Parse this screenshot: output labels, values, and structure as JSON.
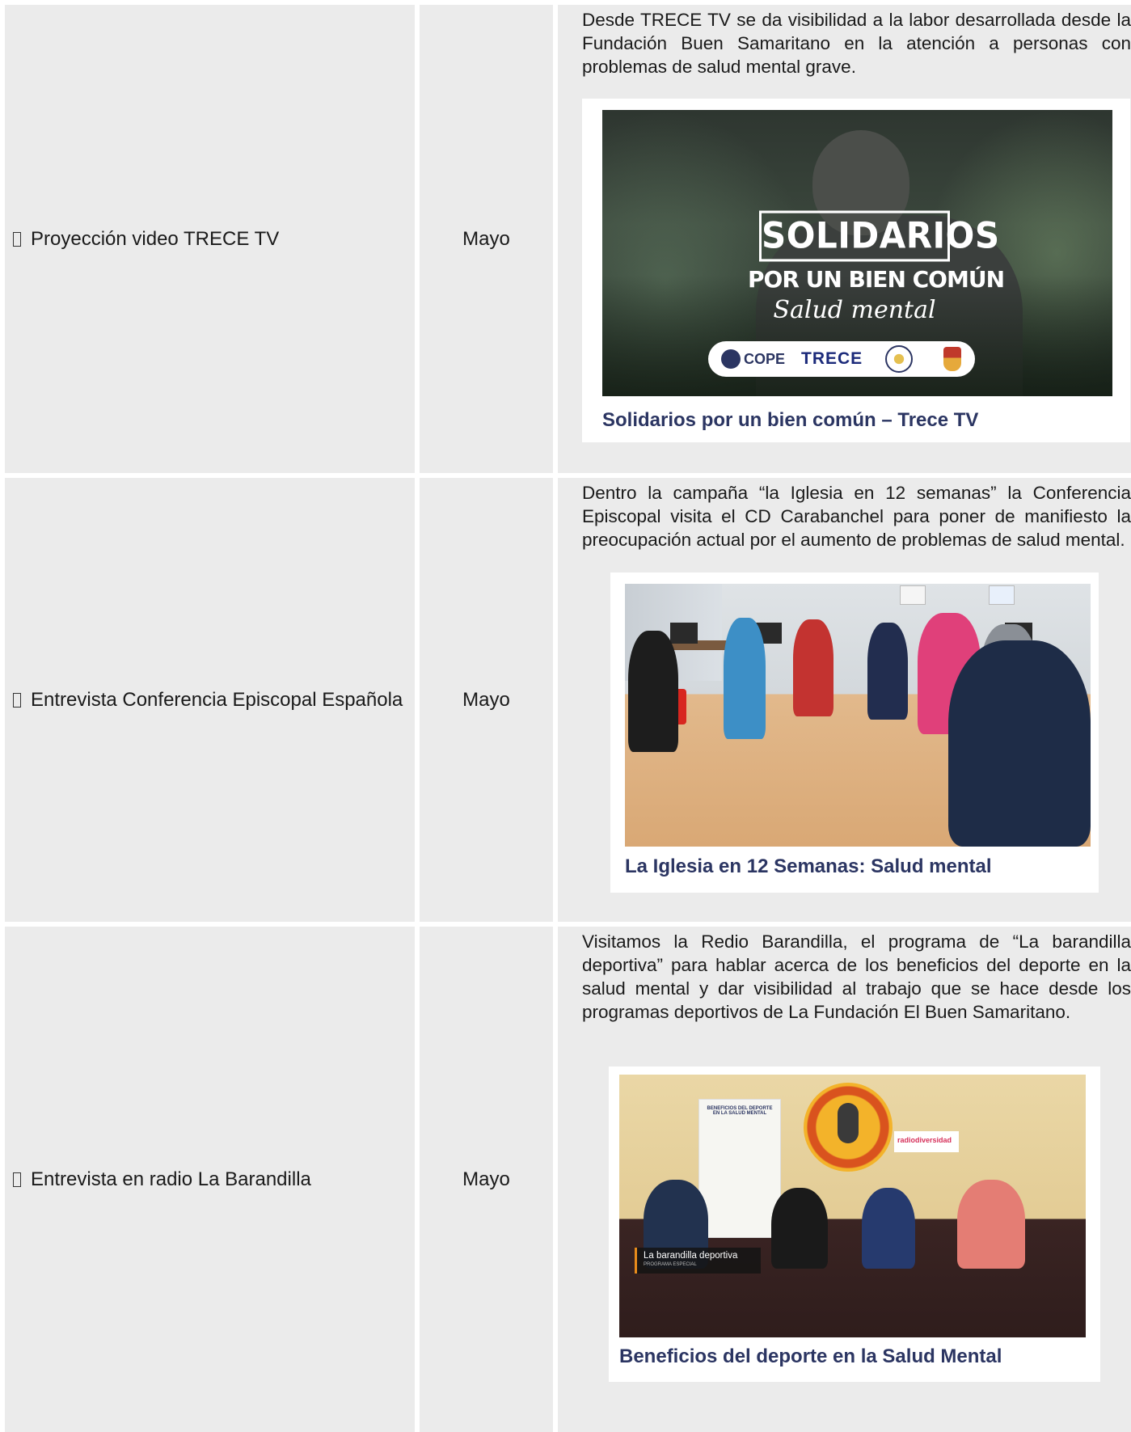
{
  "rows": [
    {
      "activity": "Proyección video TRECE TV",
      "month": "Mayo",
      "description": "Desde TRECE TV se da visibilidad a la labor desarrollada desde la Fundación Buen Samaritano en la atención a personas con problemas de salud mental grave.",
      "media": {
        "headline": "SOLIDARIOS",
        "subheadline": "POR UN BIEN COMÚN",
        "tagline": "Salud mental",
        "logos": [
          "COPE",
          "TRECE"
        ]
      },
      "card_title": "Solidarios por un bien común – Trece TV"
    },
    {
      "activity": "Entrevista Conferencia Episcopal Española",
      "month": "Mayo",
      "description": "Dentro la campaña “la Iglesia en 12 semanas” la Conferencia Episcopal visita el CD Carabanchel para poner de manifiesto la preocupación actual por el aumento de problemas de salud mental.",
      "card_title": "La Iglesia en 12 Semanas: Salud mental"
    },
    {
      "activity": "Entrevista en radio La Barandilla",
      "month": "Mayo",
      "description": "Visitamos la Redio Barandilla, el programa de “La barandilla deportiva” para hablar acerca de los beneficios del deporte en la salud mental y dar visibilidad al trabajo que se hace desde los programas deportivos de La Fundación El Buen Samaritano.",
      "media": {
        "banner_text": "BENEFICIOS DEL DEPORTE EN LA SALUD MENTAL",
        "sign_text": "radiodiversidad",
        "lower_third_title": "La barandilla deportiva",
        "lower_third_subtitle": "PROGRAMA ESPECIAL"
      },
      "card_title": "Beneficios del deporte en la Salud Mental"
    }
  ],
  "icons": {
    "row_bullet": "missing-glyph-box-icon"
  }
}
